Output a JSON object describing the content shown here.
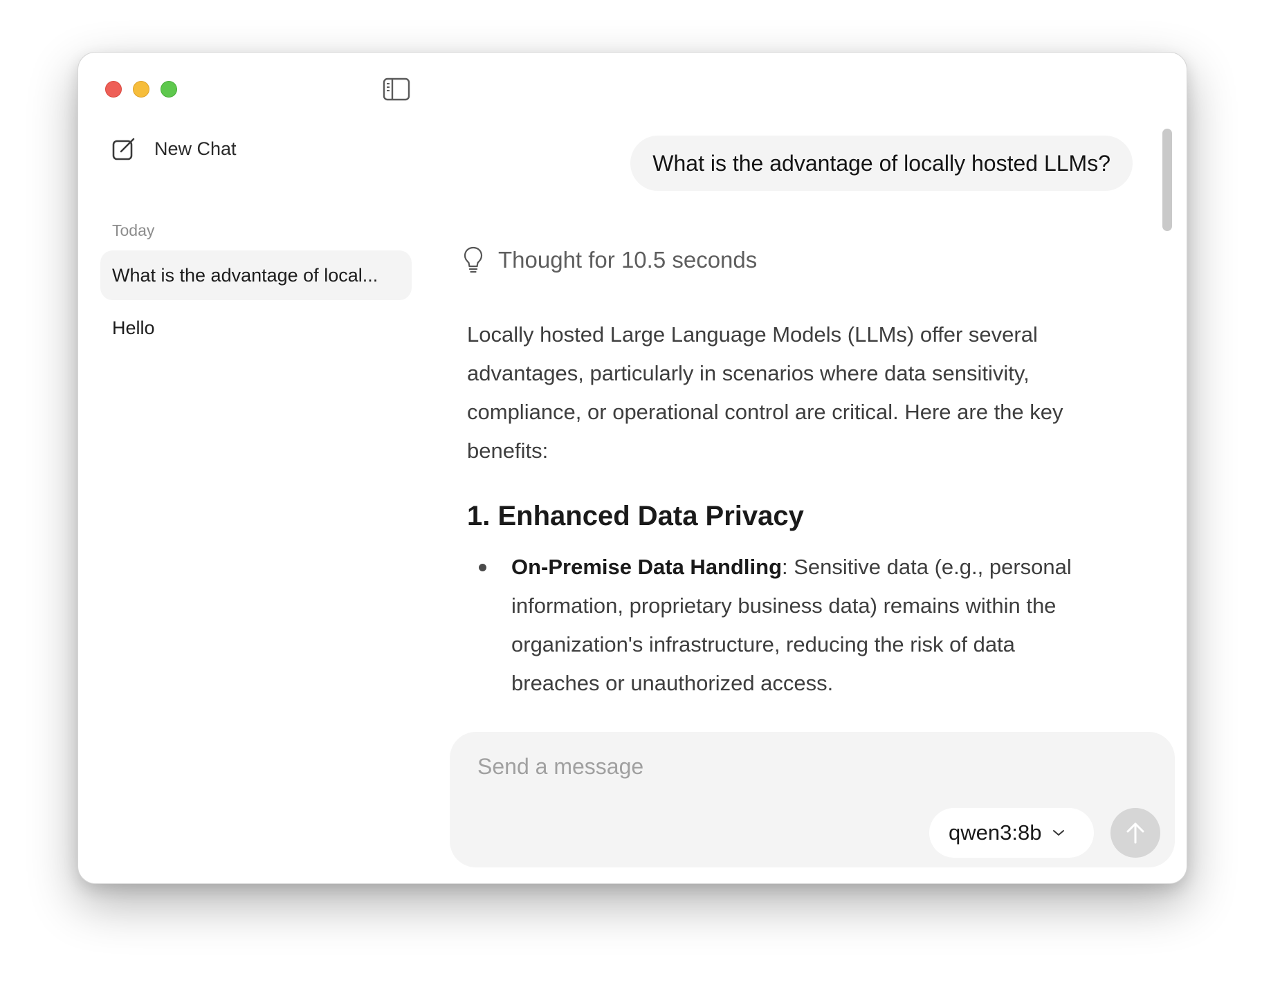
{
  "sidebar": {
    "new_chat_label": "New Chat",
    "section_label": "Today",
    "items": [
      {
        "label": "What is the advantage of local..."
      },
      {
        "label": "Hello"
      }
    ]
  },
  "chat": {
    "user_message": "What is the advantage of locally hosted LLMs?",
    "thought_label": "Thought for 10.5 seconds",
    "response_intro": "Locally hosted Large Language Models (LLMs) offer several advantages, particularly in scenarios where data sensitivity, compliance, or operational control are critical. Here are the key benefits:",
    "heading": "1. Enhanced Data Privacy",
    "bullets": [
      {
        "bold": "On-Premise Data Handling",
        "text": ": Sensitive data (e.g., personal information, proprietary business data) remains within the organization's infrastructure, reducing the risk of data breaches or unauthorized access."
      }
    ]
  },
  "composer": {
    "placeholder": "Send a message",
    "model": "qwen3:8b"
  },
  "icons": {
    "sidebar_toggle": "sidebar-toggle-icon",
    "new_chat": "compose-icon",
    "thought": "lightbulb-icon",
    "model_dropdown": "chevron-down-icon",
    "send": "arrow-up-icon"
  },
  "colors": {
    "close": "#ee5f57",
    "minimize": "#f6bd3b",
    "maximize": "#5ec84d",
    "bubble": "#f4f4f4",
    "send_disabled": "#d6d6d6"
  }
}
